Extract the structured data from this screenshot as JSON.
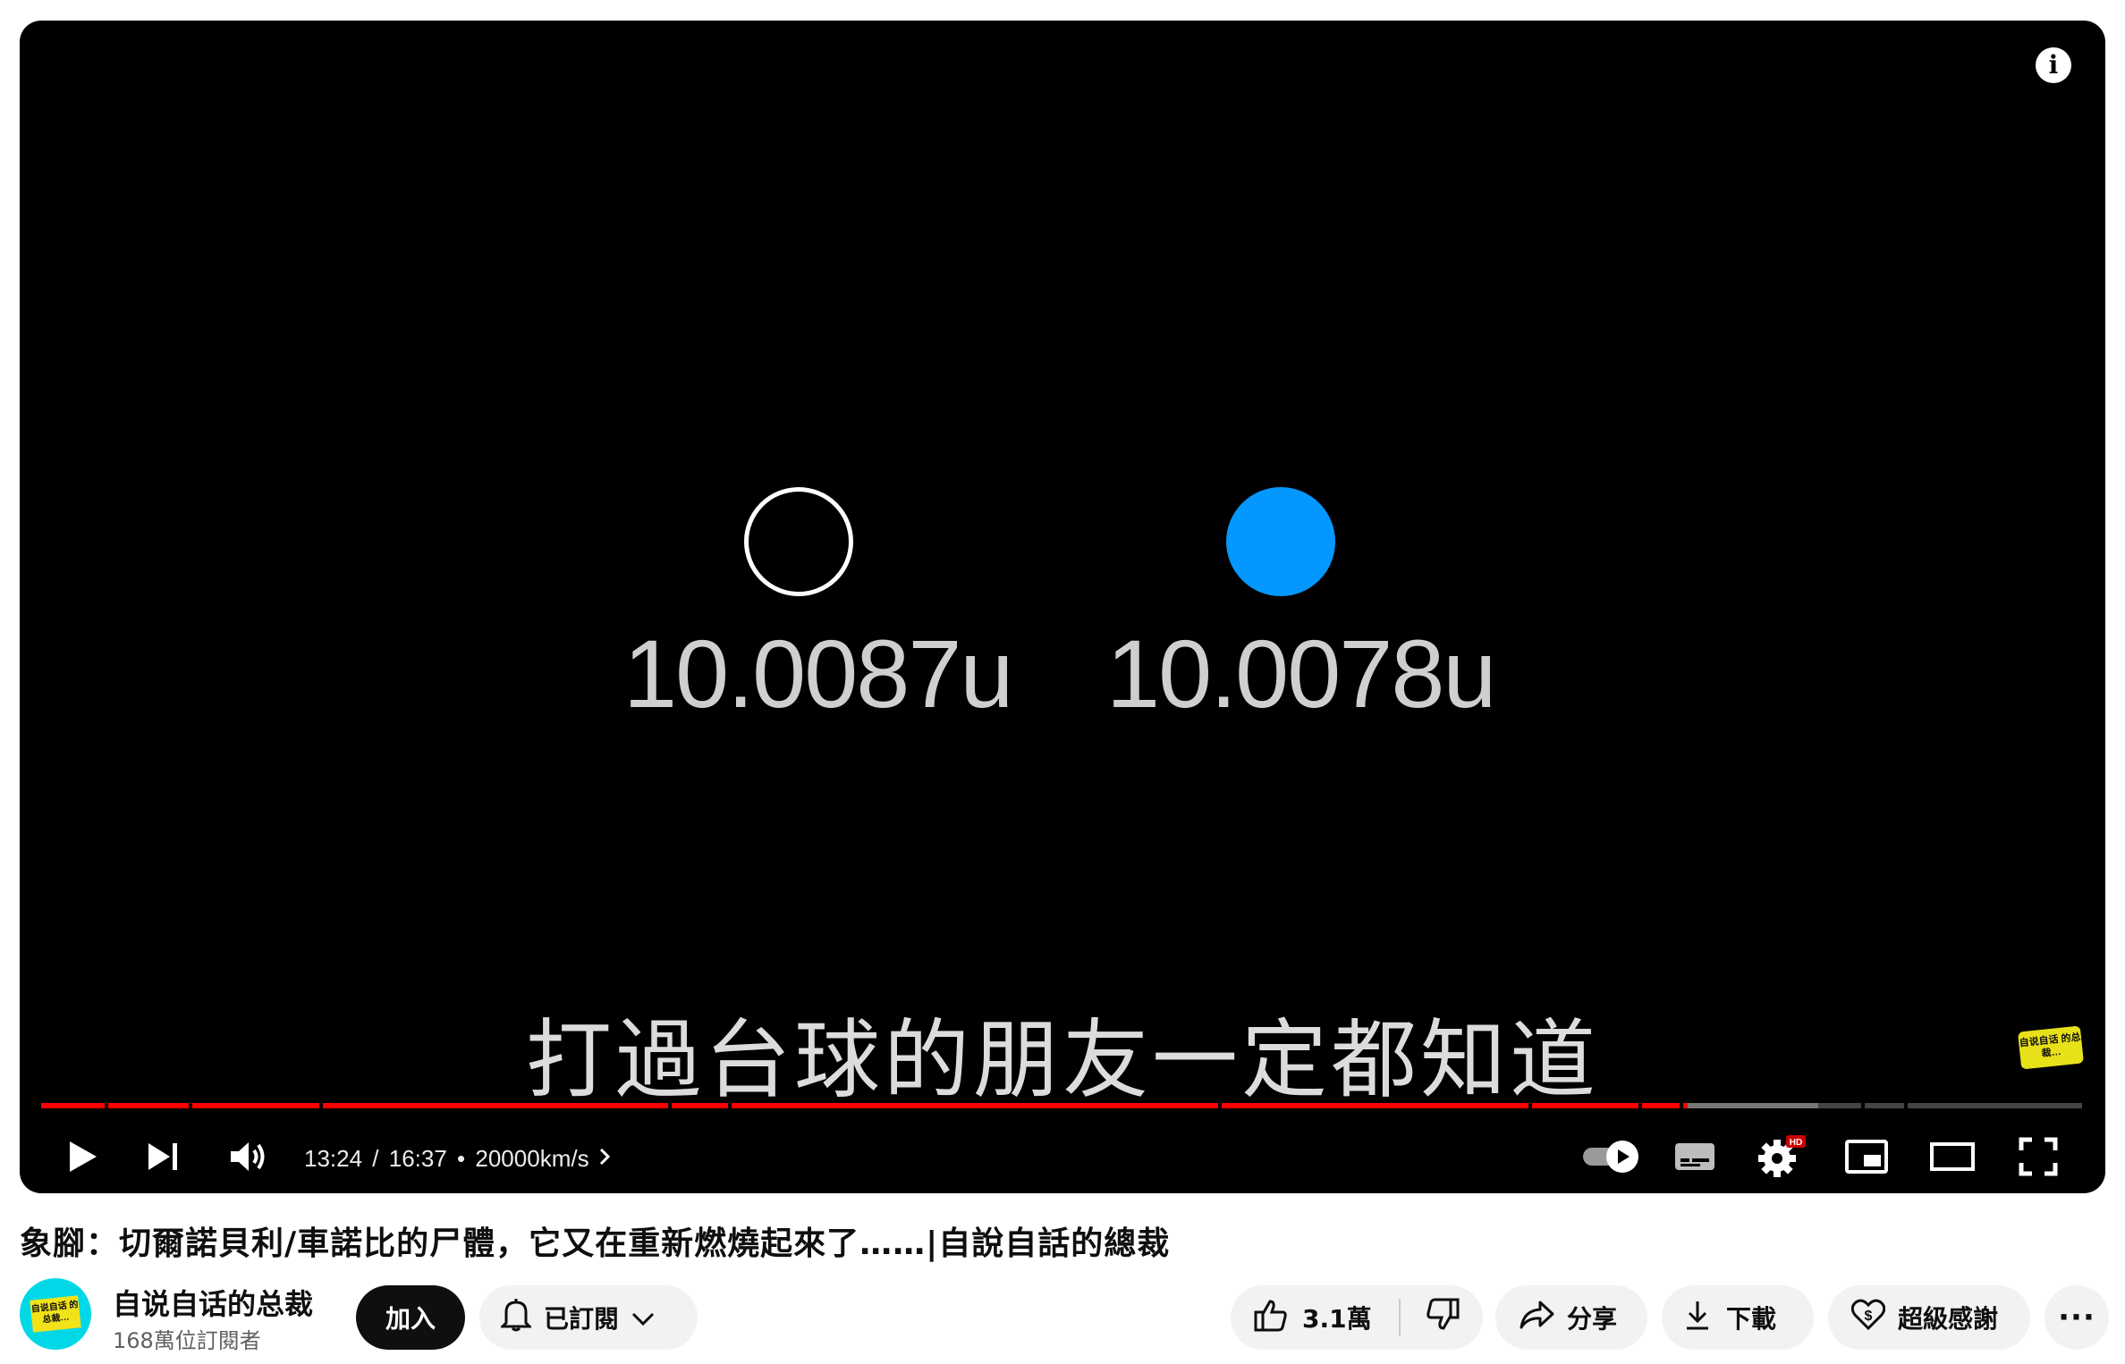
{
  "player": {
    "scene": {
      "mass_left": "10.0087u",
      "mass_right": "10.0078u",
      "proton_color": "#0497ff",
      "subtitle": "打過台球的朋友一定都知道",
      "watermark": "自说自话 的总裁…"
    },
    "progress": {
      "played_fraction": 0.806,
      "buffered_fraction": 0.87
    },
    "controls": {
      "current_time": "13:24",
      "duration": "16:37",
      "chapter": "20000km/s",
      "settings_badge": "HD"
    },
    "accent_color": "#ff0000"
  },
  "video": {
    "title": "象腳：切爾諾貝利/車諾比的尸體，它又在重新燃燒起來了……|自說自話的總裁"
  },
  "channel": {
    "avatar_text": "自说自话 的总裁…",
    "name": "自说自话的总裁",
    "subscribers": "168萬位訂閱者",
    "join_label": "加入",
    "subscribed_label": "已訂閱"
  },
  "actions": {
    "like_count": "3.1萬",
    "share_label": "分享",
    "download_label": "下載",
    "thanks_label": "超級感謝",
    "more_label": "···"
  }
}
